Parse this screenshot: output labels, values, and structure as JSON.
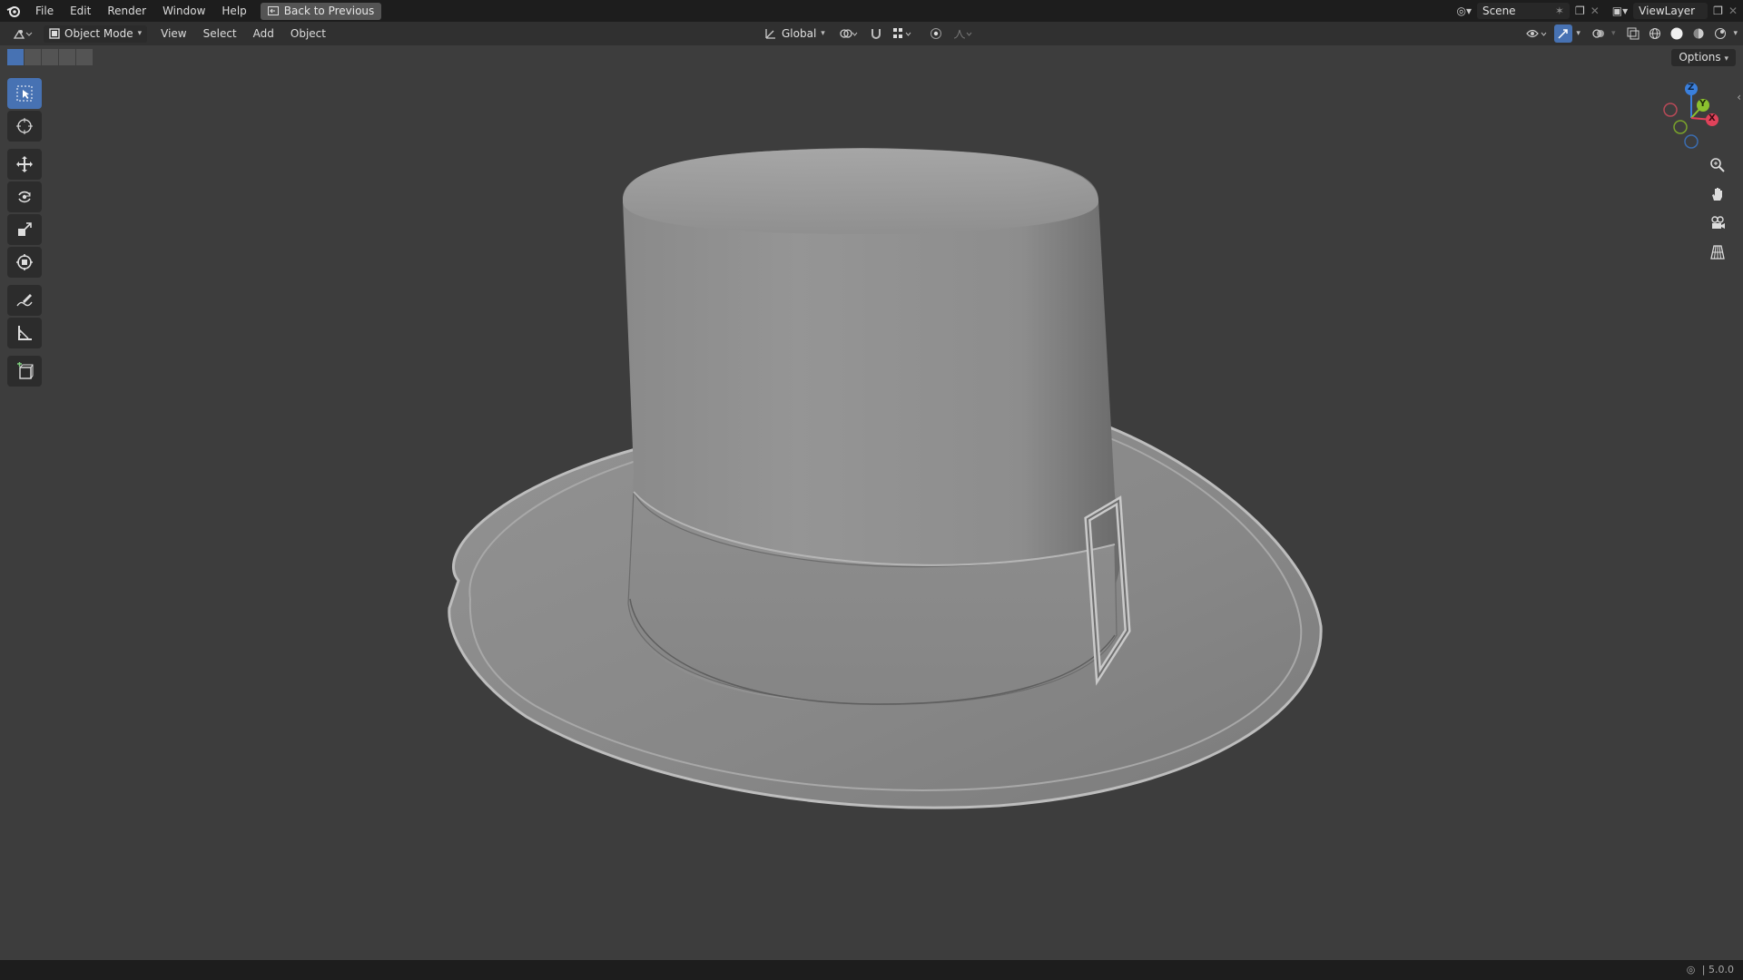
{
  "menu": {
    "items": [
      "File",
      "Edit",
      "Render",
      "Window",
      "Help"
    ],
    "back_label": "Back to Previous"
  },
  "top_right": {
    "scene": "Scene",
    "view_layer": "ViewLayer"
  },
  "header": {
    "mode": "Object Mode",
    "menus": [
      "View",
      "Select",
      "Add",
      "Object"
    ],
    "transform_orientation": "Global"
  },
  "viewport": {
    "options_label": "Options",
    "gizmo_axes": [
      "Z",
      "Y",
      "X"
    ]
  },
  "status": {
    "version": "5.0.0"
  },
  "colors": {
    "accent": "#4772b3",
    "axis_x": "#e0425a",
    "axis_y": "#8bc12e",
    "axis_z": "#3a7fdc"
  }
}
